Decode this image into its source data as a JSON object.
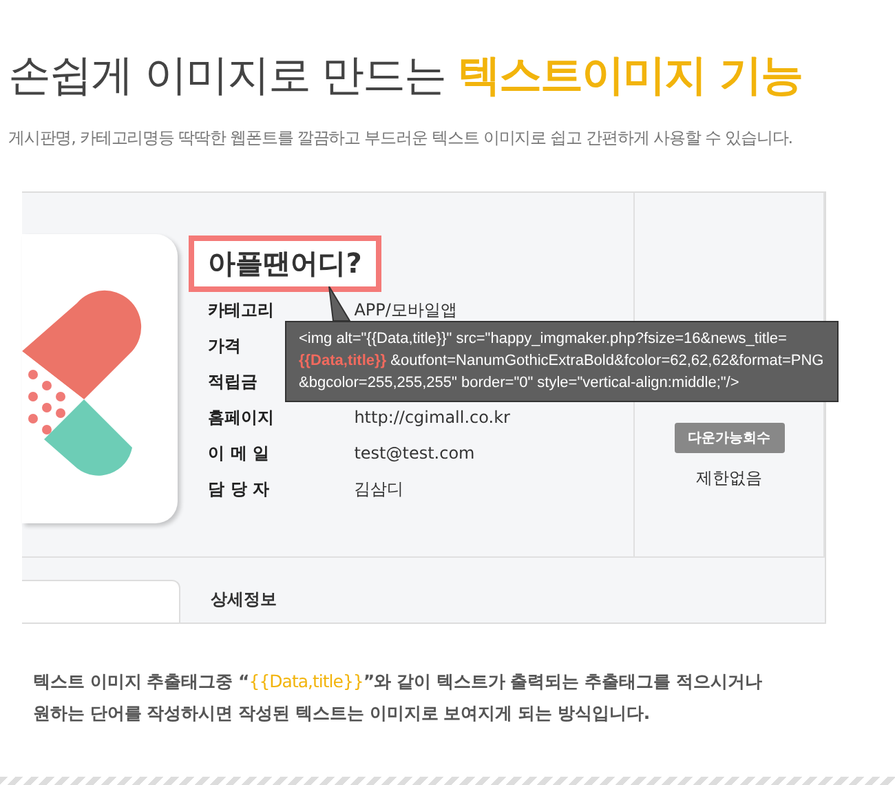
{
  "header": {
    "title": "손쉽게 이미지로 만드는",
    "title_highlight": "텍스트이미지 기능",
    "subtitle": "게시판명, 카테고리명등 딱딱한 웹폰트를 깔끔하고 부드러운 텍스트 이미지로 쉽고 간편하게 사용할 수 있습니다."
  },
  "preview": {
    "product_title": "아플땐어디?",
    "fields": [
      {
        "label": "카테고리",
        "value": "APP/모바일앱"
      },
      {
        "label": "가격"
      },
      {
        "label": "적립금"
      },
      {
        "label": "홈페이지",
        "value": "http://cgimall.co.kr"
      },
      {
        "label": "이 메 일",
        "value": "test@test.com"
      },
      {
        "label": "담 당 자",
        "value": "김삼디"
      }
    ],
    "download_button": "다운가능회수",
    "download_limit": "제한없음",
    "tab": "상세정보"
  },
  "tooltip": {
    "lines": [
      "<img alt=\"{{Data,title}}\" src=\"happy_imgmaker.php?fsize=16&news_title=",
      "**{{Data,title}}** &outfont=NanumGothicExtraBold&fcolor=62,62,62&format=PNG",
      "&bgcolor=255,255,255\" border=\"0\" style=\"vertical-align:middle;\"/>"
    ]
  },
  "description_lines": [
    "텍스트 이미지 추출태그중 “**{{Data,title}}**”와 같이 텍스트가 출력되는 추출태그를 적으시거나",
    "원하는 단어를 작성하시면 작성된 텍스트는 이미지로 보여지게 되는 방식입니다."
  ]
}
